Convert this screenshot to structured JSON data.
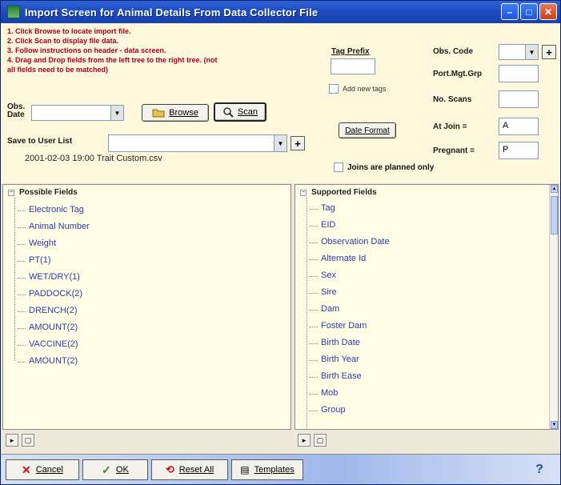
{
  "window": {
    "title": "Import Screen for Animal Details From Data Collector File",
    "controls": [
      "–",
      "□",
      "✕"
    ]
  },
  "instructions": [
    "1. Click Browse to locate import file.",
    "2. Click Scan to display file data.",
    "3. Follow instructions on header - data screen.",
    "4. Drag and Drop fields from the left tree to the right tree. (not",
    "all fields need to be matched)"
  ],
  "top": {
    "obs_date_label": "Obs.\nDate",
    "obs_date_value": "",
    "browse_label": "Browse",
    "scan_label": "Scan",
    "save_user_list_label": "Save to User List",
    "save_user_list_value": "",
    "plus": "+",
    "tag_prefix_label": "Tag Prefix",
    "tag_prefix_value": "",
    "add_new_tags_label": "Add new tags",
    "date_format_label": "Date Format",
    "obs_code_label": "Obs. Code",
    "obs_code_value": "",
    "port_mgt_grp_label": "Port.Mgt.Grp",
    "port_mgt_grp_value": "",
    "no_scans_label": "No. Scans",
    "no_scans_value": "",
    "at_join_label": "At Join =",
    "at_join_value": "A",
    "pregnant_label": "Pregnant =",
    "pregnant_value": "P",
    "joins_planned_label": "Joins are planned only",
    "file_label": "2001-02-03 19:00 Trait Custom.csv"
  },
  "possible_fields": {
    "title": "Possible Fields",
    "items": [
      "Electronic Tag",
      "Animal Number",
      "Weight",
      "PT(1)",
      "WET/DRY(1)",
      "PADDOCK(2)",
      "DRENCH(2)",
      "AMOUNT(2)",
      "VACCINE(2)",
      "AMOUNT(2)"
    ]
  },
  "supported_fields": {
    "title": "Supported Fields",
    "items": [
      "Tag",
      "EID",
      "Observation Date",
      "Alternate Id",
      "Sex",
      "Sire",
      "Dam",
      "Foster Dam",
      "Birth Date",
      "Birth Year",
      "Birth Ease",
      "Mob",
      "Group"
    ]
  },
  "bottom": {
    "cancel_label": "Cancel",
    "ok_label": "OK",
    "reset_label": "Reset All",
    "templates_label": "Templates",
    "help": "?"
  },
  "colors": {
    "title_bar": "#1F4CC0",
    "instructions": "#A8001E",
    "tree_item": "#2D3AA8",
    "panel_bg": "#FDF7DC",
    "tree_bg": "#FFFDE6"
  }
}
